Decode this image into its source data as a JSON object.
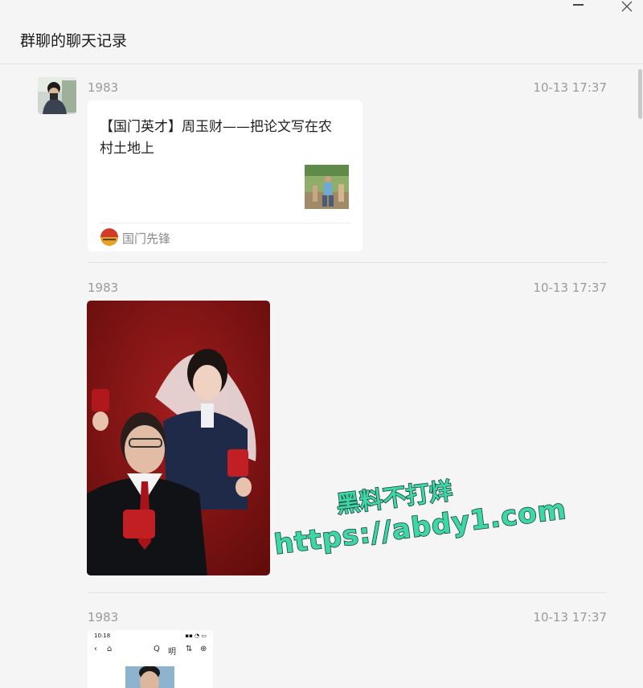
{
  "window": {
    "title": "群聊的聊天记录",
    "minimize_label": "",
    "close_label": "✕"
  },
  "messages": [
    {
      "sender": "1983",
      "time": "10-13 17:37",
      "type": "link_card",
      "card": {
        "title": "【国门英才】周玉财——把论文写在农村土地上",
        "source": "国门先锋"
      }
    },
    {
      "sender": "1983",
      "time": "10-13 17:37",
      "type": "image"
    },
    {
      "sender": "1983",
      "time": "10-13 17:37",
      "type": "image",
      "screenshot": {
        "status_time": "10:18",
        "status_right": "▪▪ ◔ ▭",
        "nav_back": "‹",
        "nav_home": "⌂",
        "nav_a": "Q",
        "nav_b": "明",
        "nav_c": "⇅",
        "nav_d": "⊕"
      }
    }
  ],
  "watermark": {
    "line1": "黑料不打烊",
    "line2": "https://abdy1.com"
  }
}
